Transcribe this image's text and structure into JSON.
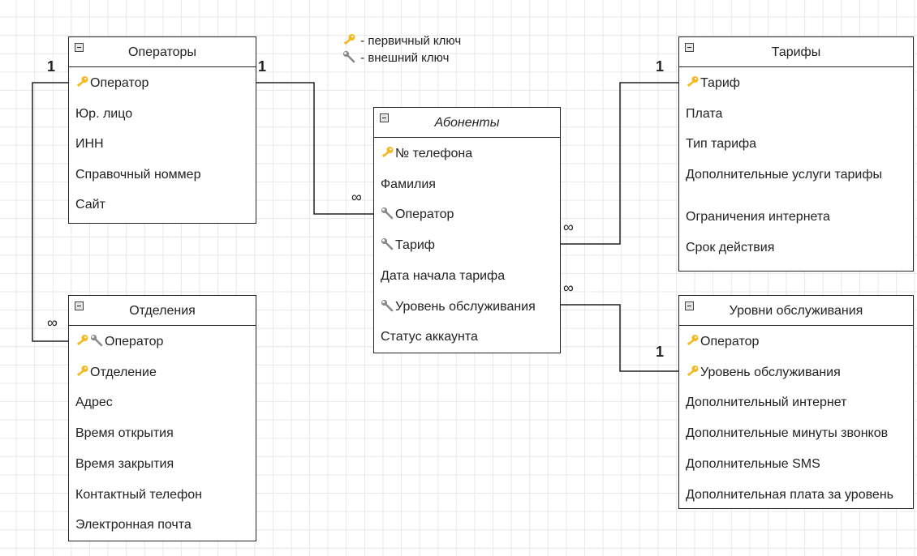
{
  "legend": {
    "primary_key": "- первичный ключ",
    "foreign_key": "- внешний ключ"
  },
  "colors": {
    "key": "#f5b820",
    "wrench": "#8a8a8a",
    "line": "#222222",
    "grid": "#e8e8e8"
  },
  "entities": {
    "operators": {
      "title": "Операторы",
      "fields": [
        {
          "label": "Оператор",
          "icons": [
            "key-icon"
          ]
        },
        {
          "label": "Юр. лицо",
          "icons": []
        },
        {
          "label": "ИНН",
          "icons": []
        },
        {
          "label": "Справочный номмер",
          "icons": []
        },
        {
          "label": "Сайт",
          "icons": []
        }
      ]
    },
    "subscribers": {
      "title": "Абоненты",
      "fields": [
        {
          "label": "№ телефона",
          "icons": [
            "key-icon"
          ]
        },
        {
          "label": "Фамилия",
          "icons": []
        },
        {
          "label": "Оператор",
          "icons": [
            "wrench-icon"
          ]
        },
        {
          "label": "Тариф",
          "icons": [
            "wrench-icon"
          ]
        },
        {
          "label": "Дата начала тарифа",
          "icons": []
        },
        {
          "label": "Уровень обслуживания",
          "icons": [
            "wrench-icon"
          ]
        },
        {
          "label": "Статус аккаунта",
          "icons": []
        }
      ]
    },
    "tariffs": {
      "title": "Тарифы",
      "fields": [
        {
          "label": "Тариф",
          "icons": [
            "key-icon"
          ]
        },
        {
          "label": "Плата",
          "icons": []
        },
        {
          "label": "Тип тарифа",
          "icons": []
        },
        {
          "label": "Дополнительные услуги тарифы",
          "icons": []
        },
        {
          "label": "Ограничения интернета",
          "icons": []
        },
        {
          "label": "Срок действия",
          "icons": []
        }
      ]
    },
    "branches": {
      "title": "Отделения",
      "fields": [
        {
          "label": "Оператор",
          "icons": [
            "key-icon",
            "wrench-icon"
          ]
        },
        {
          "label": "Отделение",
          "icons": [
            "key-icon"
          ]
        },
        {
          "label": "Адрес",
          "icons": []
        },
        {
          "label": "Время открытия",
          "icons": []
        },
        {
          "label": "Время закрытия",
          "icons": []
        },
        {
          "label": "Контактный телефон",
          "icons": []
        },
        {
          "label": "Электронная почта",
          "icons": []
        }
      ]
    },
    "service_levels": {
      "title": "Уровни обслуживания",
      "fields": [
        {
          "label": "Оператор",
          "icons": [
            "key-icon"
          ]
        },
        {
          "label": "Уровень обслуживания",
          "icons": [
            "key-icon"
          ]
        },
        {
          "label": "Дополнительный интернет",
          "icons": []
        },
        {
          "label": "Дополнительные минуты звонков",
          "icons": []
        },
        {
          "label": "Дополнительные SMS",
          "icons": []
        },
        {
          "label": "Дополнительная плата за уровень",
          "icons": []
        }
      ]
    }
  },
  "cardinalities": {
    "op_to_branch_one": "1",
    "op_to_branch_many": "∞",
    "op_to_sub_one": "1",
    "op_to_sub_many": "∞",
    "tariff_to_sub_one": "1",
    "tariff_to_sub_many": "∞",
    "level_to_sub_one": "1",
    "level_to_sub_many": "∞"
  }
}
